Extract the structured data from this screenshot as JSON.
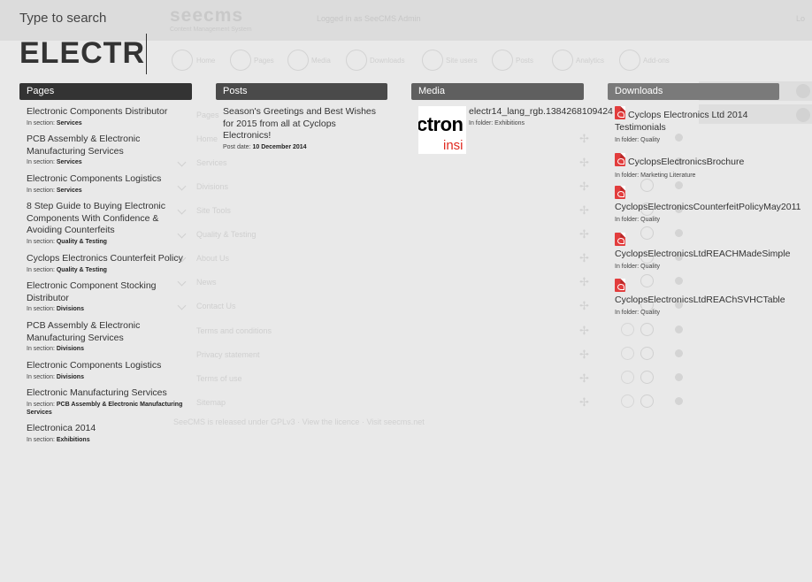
{
  "background": {
    "logo": "seecms",
    "logo_sub": "Content Management System",
    "logged_in_text": "Logged in as SeeCMS Admin",
    "logout_text": "Lo",
    "toolbar": [
      "Home",
      "Pages",
      "Media",
      "Downloads",
      "Site users",
      "Posts",
      "Analytics",
      "Add-ons"
    ],
    "tree_rows": [
      "",
      "Pages",
      "Home",
      "Services",
      "Divisions",
      "Site Tools",
      "Quality & Testing",
      "About Us",
      "News",
      "Contact Us",
      "Terms and conditions",
      "Privacy statement",
      "Terms of use",
      "Sitemap"
    ],
    "footer": "SeeCMS is released under GPLv3 · View the licence · Visit seecms.net"
  },
  "search": {
    "label": "Type to search",
    "value": "ELECTR"
  },
  "columns": {
    "pages": {
      "title": "Pages",
      "color": "#333333",
      "items": [
        {
          "title": "Electronic Components Distributor",
          "meta_prefix": "In section: ",
          "meta_value": "Services"
        },
        {
          "title": "PCB Assembly & Electronic Manufacturing Services",
          "meta_prefix": "In section: ",
          "meta_value": "Services"
        },
        {
          "title": "Electronic Components Logistics",
          "meta_prefix": "In section: ",
          "meta_value": "Services"
        },
        {
          "title": "8 Step Guide to Buying Electronic Components With Confidence & Avoiding Counterfeits",
          "meta_prefix": "In section: ",
          "meta_value": "Quality & Testing"
        },
        {
          "title": "Cyclops Electronics Counterfeit Policy",
          "meta_prefix": "In section: ",
          "meta_value": "Quality & Testing"
        },
        {
          "title": "Electronic Component Stocking Distributor",
          "meta_prefix": "In section: ",
          "meta_value": "Divisions"
        },
        {
          "title": "PCB Assembly & Electronic Manufacturing Services",
          "meta_prefix": "In section: ",
          "meta_value": "Divisions"
        },
        {
          "title": "Electronic Components Logistics",
          "meta_prefix": "In section: ",
          "meta_value": "Divisions"
        },
        {
          "title": "Electronic Manufacturing Services",
          "meta_prefix": "In section: ",
          "meta_value": "PCB Assembly & Electronic Manufacturing Services"
        },
        {
          "title": "Electronica 2014",
          "meta_prefix": "In section: ",
          "meta_value": "Exhibitions"
        }
      ]
    },
    "posts": {
      "title": "Posts",
      "color": "#4a4a4a",
      "items": [
        {
          "title": "Season's Greetings and Best Wishes for 2015 from all at Cyclops Electronics!",
          "meta_prefix": "Post date: ",
          "meta_value": "10 December 2014"
        }
      ]
    },
    "media": {
      "title": "Media",
      "color": "#5f5f5f",
      "items": [
        {
          "title": "electr14_lang_rgb.1384268109424",
          "meta": "In folder: Exhibitions",
          "thumb_text_1": "ctron",
          "thumb_text_2": "insi"
        }
      ]
    },
    "downloads": {
      "title": "Downloads",
      "color": "#7a7a7a",
      "items": [
        {
          "icon": "pdf-icon",
          "title": "Cyclops Electronics Ltd 2014 Testimonials",
          "meta": "In folder: Quality"
        },
        {
          "icon": "pdf-icon",
          "title": "CyclopsElectronicsBrochure",
          "meta": "In folder: Marketing Literature"
        },
        {
          "icon": "pdf-icon",
          "title": "CyclopsElectronicsCounterfeitPolicyMay2011",
          "meta": "In folder: Quality"
        },
        {
          "icon": "pdf-icon",
          "title": "CyclopsElectronicsLtdREACHMadeSimple",
          "meta": "In folder: Quality"
        },
        {
          "icon": "pdf-icon",
          "title": "CyclopsElectronicsLtdREAChSVHCTable",
          "meta": "In folder: Quality"
        }
      ]
    }
  }
}
